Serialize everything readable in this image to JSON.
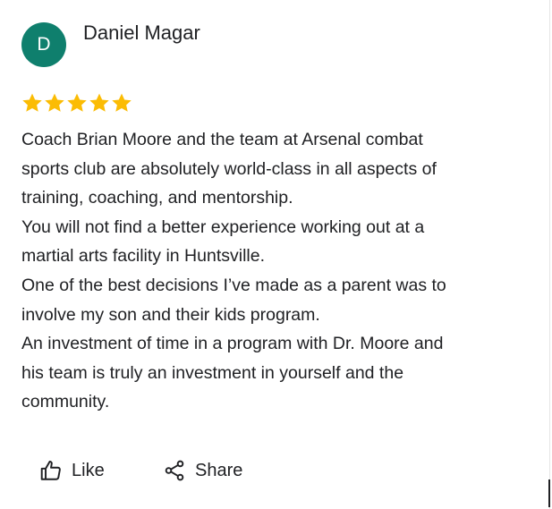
{
  "review": {
    "avatar_letter": "D",
    "avatar_color": "#0f7f6d",
    "reviewer_name": "Daniel Magar",
    "rating": 5,
    "star_color": "#fbbc04",
    "lines": [
      "Coach Brian Moore and the team at Arsenal combat",
      "sports club are absolutely world-class in all aspects of",
      "training, coaching, and mentorship.",
      "You will not find a better experience working out at a",
      "martial arts facility in Huntsville.",
      "One of the best decisions I’ve made as a parent was to",
      "involve my son and their kids program.",
      "An investment of time in a program with Dr. Moore and",
      "his team is truly an investment in yourself and the",
      "community."
    ]
  },
  "actions": {
    "like_label": "Like",
    "like_icon": "thumbs-up-icon",
    "share_label": "Share",
    "share_icon": "share-icon"
  }
}
